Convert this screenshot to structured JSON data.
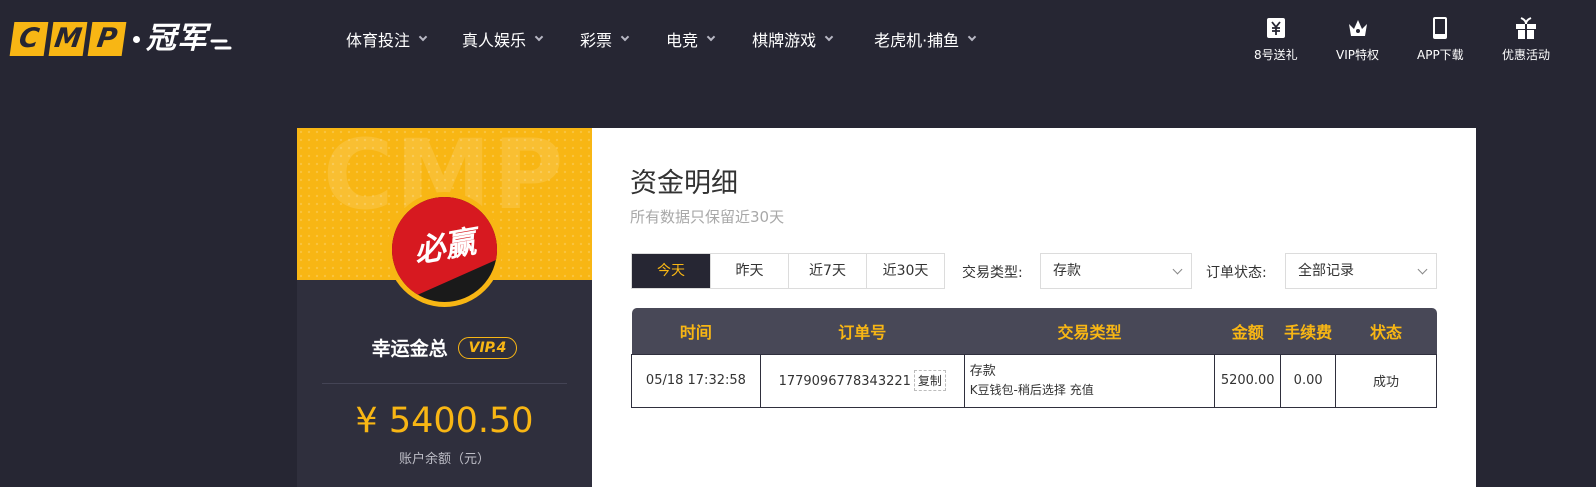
{
  "logo": {
    "letters": [
      "C",
      "M",
      "P"
    ],
    "cn": "冠军",
    "suffix": ""
  },
  "nav": [
    {
      "label": "体育投注"
    },
    {
      "label": "真人娱乐"
    },
    {
      "label": "彩票"
    },
    {
      "label": "电竞"
    },
    {
      "label": "棋牌游戏"
    },
    {
      "label": "老虎机·捕鱼"
    }
  ],
  "quick_links": [
    {
      "label": "8号送礼",
      "icon": "yen-gift-icon"
    },
    {
      "label": "VIP特权",
      "icon": "crown-icon"
    },
    {
      "label": "APP下载",
      "icon": "phone-icon"
    },
    {
      "label": "优惠活动",
      "icon": "gift-icon"
    }
  ],
  "profile": {
    "watermark": "CMP",
    "avatar_text": "必赢",
    "username": "幸运金总",
    "vip": "VIP.4",
    "balance": "¥ 5400.50",
    "balance_label": "账户余额（元）"
  },
  "page": {
    "title": "资金明细",
    "subtitle": "所有数据只保留近30天"
  },
  "tabs": [
    {
      "label": "今天",
      "active": true
    },
    {
      "label": "昨天",
      "active": false
    },
    {
      "label": "近7天",
      "active": false
    },
    {
      "label": "近30天",
      "active": false
    }
  ],
  "filters": {
    "type_label": "交易类型:",
    "type_value": "存款",
    "status_label": "订单状态:",
    "status_value": "全部记录"
  },
  "table": {
    "headers": [
      "时间",
      "订单号",
      "交易类型",
      "金额",
      "手续费",
      "状态"
    ],
    "rows": [
      {
        "time": "05/18 17:32:58",
        "order_no": "1779096778343221",
        "copy": "复制",
        "type": "存款",
        "type_detail": "K豆钱包-稍后选择 充值",
        "amount": "5200.00",
        "fee": "0.00",
        "status": "成功"
      }
    ]
  },
  "colors": {
    "accent": "#f8b614",
    "background": "#262633",
    "panel_dark": "#2f2f3d",
    "success": "#1a8c1a"
  }
}
